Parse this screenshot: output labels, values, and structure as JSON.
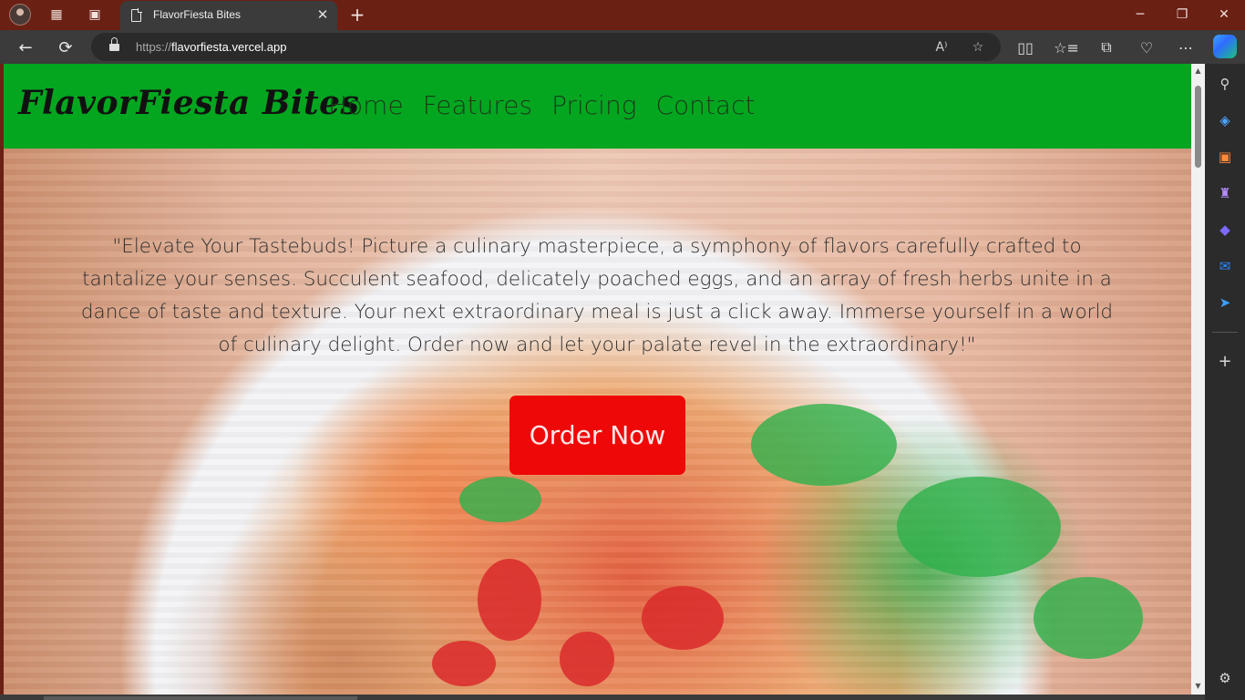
{
  "browser": {
    "tab": {
      "title": "FlavorFiesta Bites",
      "close_glyph": "✕"
    },
    "new_tab_glyph": "+",
    "address": {
      "protocol": "https://",
      "host": "flavorfiesta.vercel.app"
    },
    "icons": {
      "back": "←",
      "refresh": "⟳",
      "read_aloud": "A⁾",
      "favorite": "☆",
      "split_screen": "▯▯",
      "favorites": "☆≡",
      "collections": "⧉",
      "browser_essentials": "♡",
      "more": "⋯",
      "minimize": "─",
      "maximize": "❐",
      "close": "✕"
    },
    "sidebar_icons": {
      "search": "⚲",
      "shopping": "◈",
      "tools": "▣",
      "games": "♜",
      "copilot": "◆",
      "outlook": "✉",
      "send": "➤",
      "add": "+",
      "settings": "⚙"
    }
  },
  "site": {
    "brand": "FlavorFiesta Bites",
    "nav": [
      "Home",
      "Features",
      "Pricing",
      "Contact"
    ],
    "tagline": "\"Elevate Your Tastebuds! Picture a culinary masterpiece, a symphony of flavors carefully crafted to tantalize your senses. Succulent seafood, delicately poached eggs, and an array of fresh herbs unite in a dance of taste and texture. Your next extraordinary meal is just a click away. Immerse yourself in a world of culinary delight. Order now and let your palate revel in the extraordinary!\"",
    "cta": "Order Now"
  },
  "colors": {
    "titlebar": "#6b2014",
    "header_green": "#04a620",
    "cta_red": "#ee0808"
  }
}
